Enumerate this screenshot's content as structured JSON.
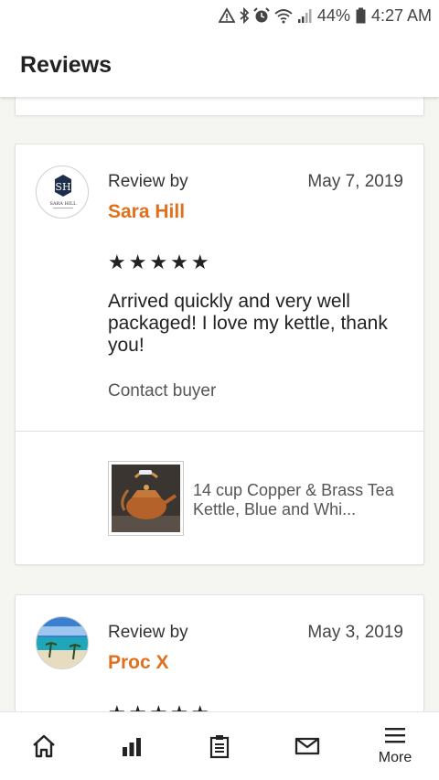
{
  "status": {
    "battery": "44%",
    "time": "4:27 AM"
  },
  "header": {
    "title": "Reviews"
  },
  "reviews": [
    {
      "label": "Review by",
      "reviewer": "Sara Hill",
      "date": "May 7, 2019",
      "stars": "★★★★★",
      "rating": 5,
      "text": "Arrived quickly and very well packaged! I love my kettle, thank you!",
      "contact": "Contact buyer",
      "item_title": "14 cup Copper & Brass Tea Kettle, Blue and Whi...",
      "avatar_text": "SARA HILL"
    },
    {
      "label": "Review by",
      "reviewer": "Proc X",
      "date": "May 3, 2019",
      "stars": "★★★★★",
      "rating": 5
    }
  ],
  "nav": {
    "more_label": "More"
  },
  "colors": {
    "accent": "#e1701d",
    "text": "#222222",
    "background": "#f5f5f1"
  }
}
